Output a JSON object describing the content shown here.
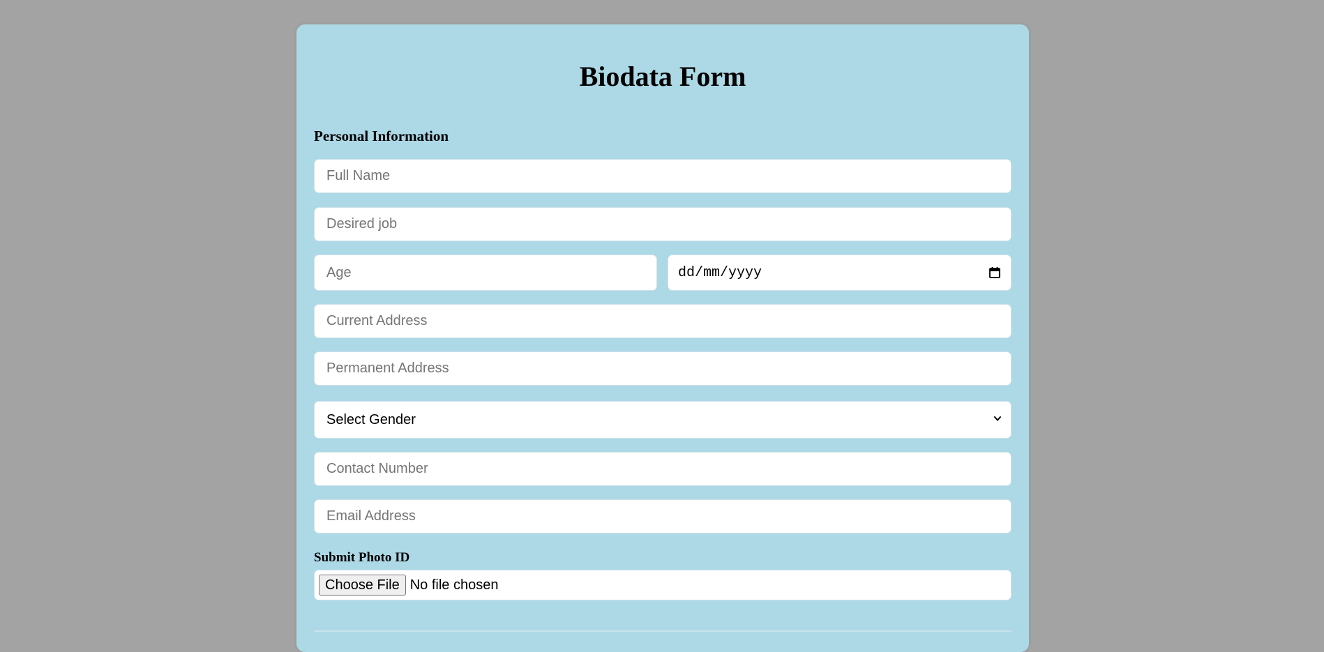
{
  "form": {
    "title": "Biodata Form",
    "section_heading": "Personal Information",
    "fields": {
      "full_name": {
        "placeholder": "Full Name",
        "value": ""
      },
      "desired_job": {
        "placeholder": "Desired job",
        "value": ""
      },
      "age": {
        "placeholder": "Age",
        "value": ""
      },
      "date_of_birth": {
        "display": "dd/mm/yyyy"
      },
      "current_address": {
        "placeholder": "Current Address",
        "value": ""
      },
      "permanent_address": {
        "placeholder": "Permanent Address",
        "value": ""
      },
      "gender": {
        "selected": "Select Gender"
      },
      "contact_number": {
        "placeholder": "Contact Number",
        "value": ""
      },
      "email_address": {
        "placeholder": "Email Address",
        "value": ""
      }
    },
    "photo_id": {
      "label": "Submit Photo ID",
      "button_label": "Choose File",
      "status": "No file chosen"
    }
  },
  "icons": {
    "date_picker": "calendar-icon",
    "select_arrow": "chevron-down-icon"
  },
  "colors": {
    "page_background": "#a3a3a3",
    "card_background": "#add8e6",
    "field_background": "#ffffff",
    "placeholder_text": "#757575"
  }
}
